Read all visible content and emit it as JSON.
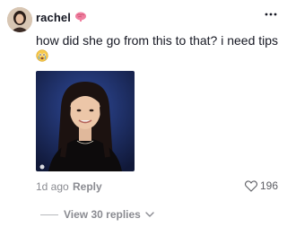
{
  "comment": {
    "username": "rachel",
    "username_emoji": "brain-emoji",
    "text": "how did she go from this to that? i need tips",
    "text_emoji": "crying-emoji",
    "time": "1d ago",
    "reply_label": "Reply",
    "like_count": "196",
    "view_replies_label": "View 30 replies"
  },
  "icons": {
    "more": "more-dots-icon",
    "like": "heart-outline-icon",
    "expand": "chevron-down-icon"
  },
  "colors": {
    "primary_text": "#161823",
    "secondary_text": "#8a8b91",
    "photo_background": "#1e2a5c"
  }
}
